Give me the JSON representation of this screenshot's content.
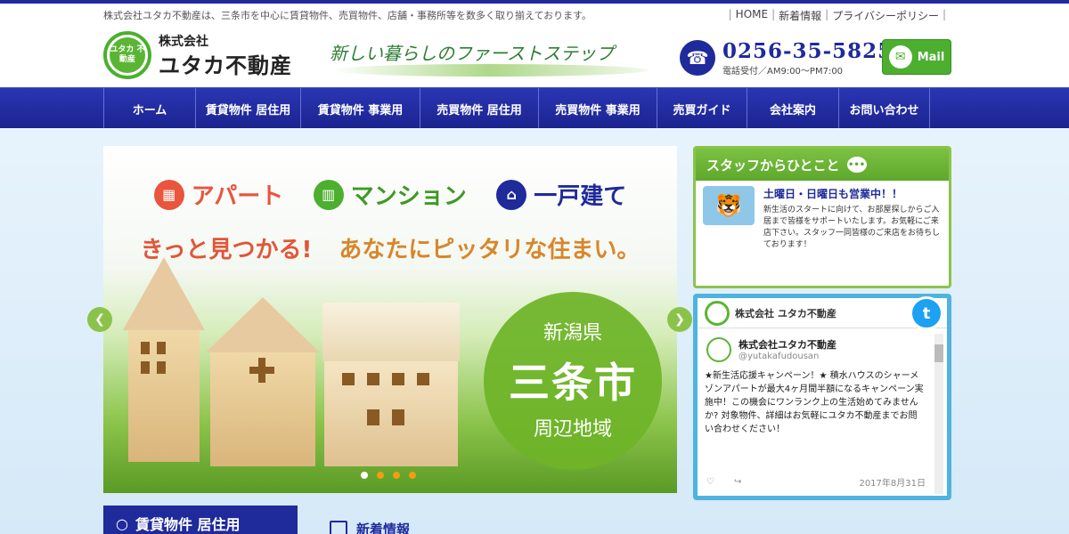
{
  "header": {
    "tagline": "株式会社ユタカ不動産は、三条市を中心に賃貸物件、売買物件、店舗・事務所等を数多く取り揃えております。",
    "links": [
      "HOME",
      "新着情報",
      "プライバシーポリシー"
    ],
    "logo_small": "株式会社",
    "logo_big": "ユタカ不動産",
    "logo_mark": "ユタカ 不動産",
    "catch": "新しい暮らしのファーストステップ",
    "phone": "0256-35-5825",
    "hours": "電話受付／AM9:00～PM7:00",
    "mail_label": "Mail"
  },
  "nav": [
    "ホーム",
    "賃貸物件 居住用",
    "賃貸物件 事業用",
    "売買物件 居住用",
    "売買物件 事業用",
    "売買ガイド",
    "会社案内",
    "お問い合わせ"
  ],
  "slider": {
    "categories": [
      "アパート",
      "マンション",
      "一戸建て"
    ],
    "slogan_a": "きっと見つかる!",
    "slogan_b": "あなたにピッタリな住まい。",
    "badge_pref": "新潟県",
    "badge_city": "三条市",
    "badge_area": "周辺地域",
    "dots": 4,
    "active_dot": 1
  },
  "staff": {
    "heading": "スタッフからひとこと",
    "title": "土曜日・日曜日も営業中！！",
    "message": "新生活のスタートに向けて、お部屋探しからご入居まで皆様をサポートいたします。お気軽にご来店下さい。スタッフ一同皆様のご来店をお待ちしております！"
  },
  "twitter": {
    "header_name": "株式会社 ユタカ不動産",
    "name": "株式会社ユタカ不動産",
    "handle": "@yutakafudousan",
    "body": "★新生活応援キャンペーン！★ 積水ハウスのシャーメゾンアパートが最大4ヶ月間半額になるキャンペーン実施中！この機会にワンランク上の生活始めてみませんか? 対象物件、詳細はお気軽にユタカ不動産までお問い合わせください！",
    "date": "2017年8月31日"
  },
  "bottom": {
    "rent_label": "賃貸物件 居住用",
    "news_label": "新着情報"
  },
  "colors": {
    "brand_blue": "#1f2a9b",
    "brand_green": "#5ab534",
    "twitter_blue": "#4fb3e0"
  }
}
